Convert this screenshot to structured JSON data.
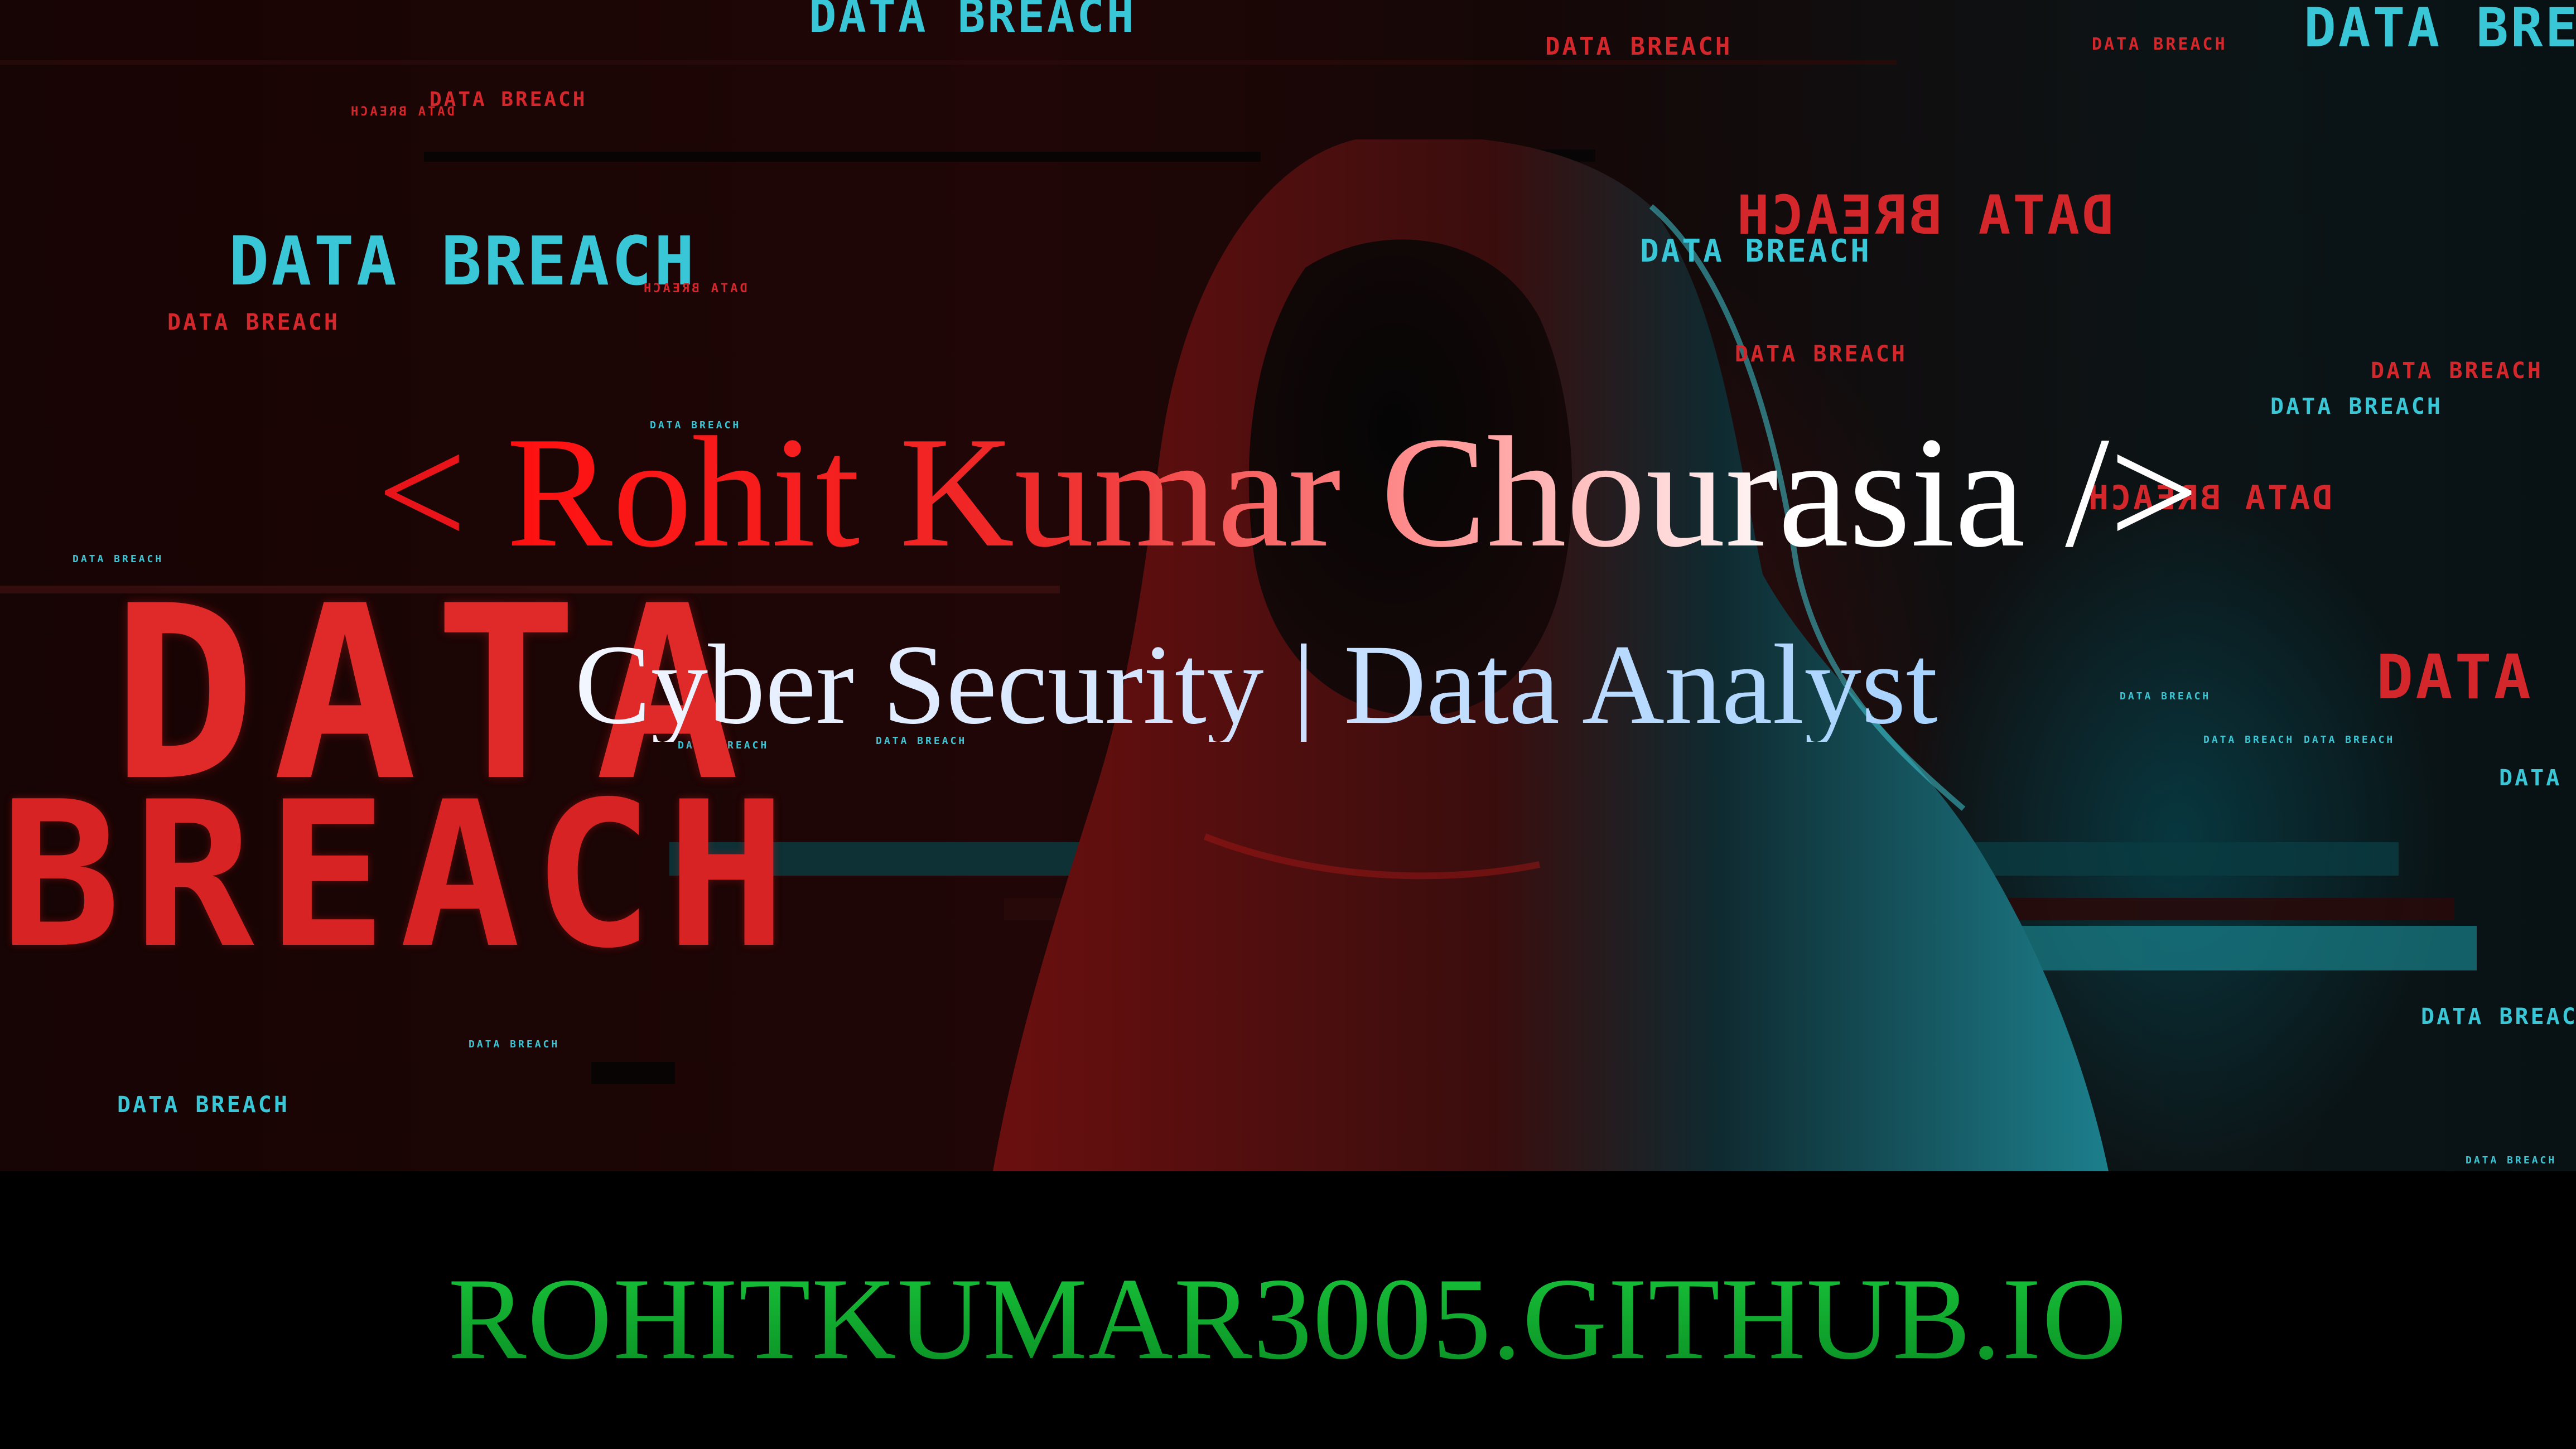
{
  "banner": {
    "open_tag": "<",
    "name": "Rohit Kumar Chourasia",
    "close_tag": "/>",
    "subtitle": "Cyber Security | Data Analyst",
    "url": "ROHITKUMAR3005.GITHUB.IO"
  },
  "background": {
    "repeated_text": "DATA BREACH",
    "big_word_1": "DATA",
    "big_word_2": "BREACH",
    "colors": {
      "red": "#d4272c",
      "cyan": "#39c6d6",
      "url_green": "#0ea52a",
      "title_red": "#e8141a"
    }
  }
}
